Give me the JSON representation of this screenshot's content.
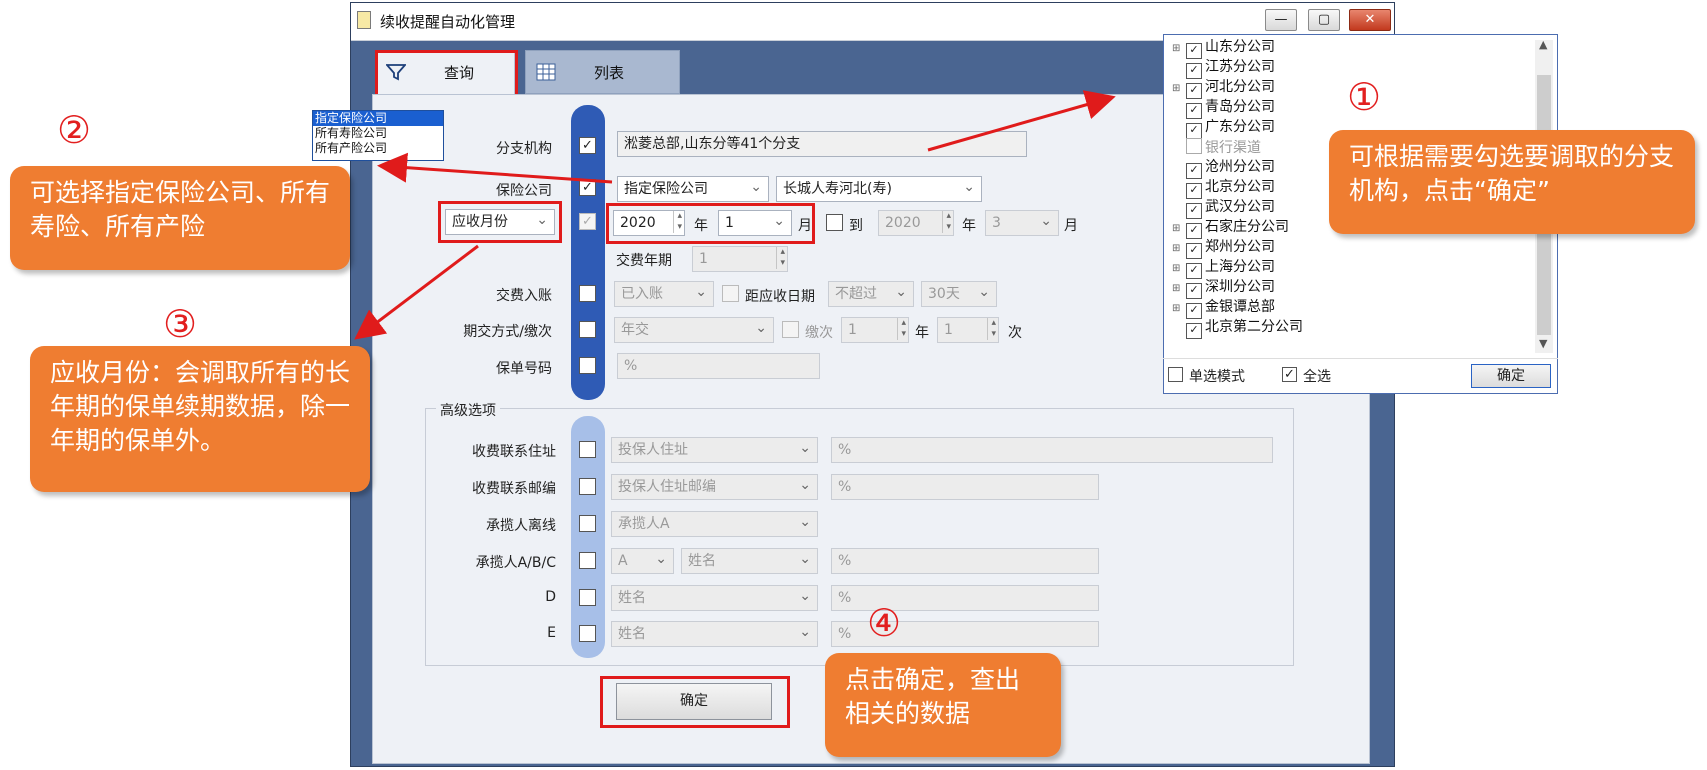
{
  "window": {
    "title": "续收提醒自动化管理",
    "minimize": "—",
    "maximize": "▢",
    "close": "✕"
  },
  "tabs": [
    {
      "label": "查询",
      "icon": "filter-icon"
    },
    {
      "label": "列表",
      "icon": "table-icon"
    }
  ],
  "form": {
    "branch_label": "分支机构",
    "branch_value": "淞菱总部,山东分等41个分支",
    "insurer_label": "保险公司",
    "insurer_type": "指定保险公司",
    "insurer_value": "长城人寿河北(寿)",
    "month_type": "应收月份",
    "year_from": "2020",
    "year_unit": "年",
    "month_from": "1",
    "month_unit": "月",
    "to_label": "到",
    "year_to": "2020",
    "month_to": "3",
    "pay_period_label": "交费年期",
    "pay_period_value": "1",
    "account_label": "交费入账",
    "account_value": "已入账",
    "due_label": "距应收日期",
    "due_cmp": "不超过",
    "due_days": "30天",
    "method_label": "期交方式/缴次",
    "method_value": "年交",
    "times_label": "缴次",
    "times_year": "1",
    "times_year_unit": "年",
    "times_value": "1",
    "times_unit": "次",
    "policy_label": "保单号码",
    "policy_value": "%"
  },
  "advanced": {
    "title": "高级选项",
    "rows": [
      {
        "label": "收费联系住址",
        "select": "投保人住址",
        "value": "%"
      },
      {
        "label": "收费联系邮编",
        "select": "投保人住址邮编",
        "value": "%"
      },
      {
        "label": "承揽人离线",
        "select": "承揽人A"
      },
      {
        "label": "承揽人A/B/C",
        "select_a": "A",
        "select": "姓名",
        "value": "%"
      },
      {
        "label": "D",
        "select": "姓名",
        "value": "%"
      },
      {
        "label": "E",
        "select": "姓名",
        "value": "%"
      }
    ]
  },
  "confirm_label": "确定",
  "dropdown_options": [
    "指定保险公司",
    "所有寿险公司",
    "所有产险公司"
  ],
  "tree": {
    "items": [
      {
        "label": "山东分公司",
        "checked": true,
        "expandable": true
      },
      {
        "label": "江苏分公司",
        "checked": true,
        "expandable": false
      },
      {
        "label": "河北分公司",
        "checked": true,
        "expandable": true
      },
      {
        "label": "青岛分公司",
        "checked": true,
        "expandable": false
      },
      {
        "label": "广东分公司",
        "checked": true,
        "expandable": false
      },
      {
        "label": "银行渠道",
        "checked": false,
        "expandable": false
      },
      {
        "label": "沧州分公司",
        "checked": true,
        "expandable": false
      },
      {
        "label": "北京分公司",
        "checked": true,
        "expandable": false
      },
      {
        "label": "武汉分公司",
        "checked": true,
        "expandable": false
      },
      {
        "label": "石家庄分公司",
        "checked": true,
        "expandable": true
      },
      {
        "label": "郑州分公司",
        "checked": true,
        "expandable": true
      },
      {
        "label": "上海分公司",
        "checked": true,
        "expandable": true
      },
      {
        "label": "深圳分公司",
        "checked": true,
        "expandable": true
      },
      {
        "label": "金银谭总部",
        "checked": true,
        "expandable": true
      },
      {
        "label": "北京第二分公司",
        "checked": true,
        "expandable": false
      }
    ],
    "single_mode": "单选模式",
    "select_all": "全选",
    "confirm": "确定"
  },
  "annotations": {
    "n1": "①",
    "n2": "②",
    "n3": "③",
    "n4": "④",
    "c1": "可根据需要勾选要调取的分支机构，点击“确定”",
    "c2": "可选择指定保险公司、所有寿险、所有产险",
    "c3": "应收月份：会调取所有的长年期的保单续期数据，除一年期的保单外。",
    "c4": "点击确定，查出相关的数据"
  },
  "colors": {
    "accent_orange": "#ef7d31",
    "annotation_red": "#e01b1b",
    "pill_blue": "#2f5bb5",
    "window_blue": "#4a6591"
  }
}
